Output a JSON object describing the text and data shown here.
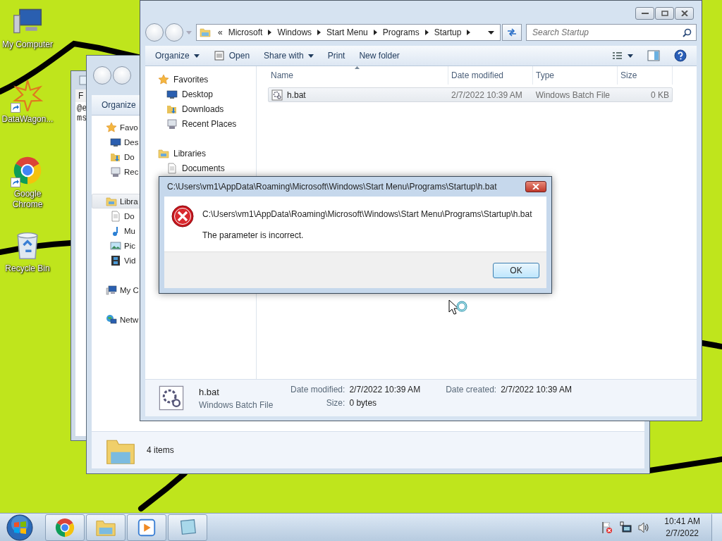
{
  "desktop_icons": [
    {
      "label": "My Computer",
      "kind": "computer",
      "shortcut": false
    },
    {
      "label": "DataWagon...",
      "kind": "star",
      "shortcut": true
    },
    {
      "label": "Google Chrome",
      "kind": "chrome",
      "shortcut": true
    },
    {
      "label": "Recycle Bin",
      "kind": "recycle",
      "shortcut": false
    }
  ],
  "notepad": {
    "menu": "F",
    "lines": [
      "@e",
      "ms"
    ]
  },
  "back_explorer": {
    "toolbar": "Organize",
    "sidebar": [
      {
        "label": "Favo",
        "kind": "star",
        "selected": false,
        "children": [
          {
            "label": "Des",
            "kind": "desktop",
            "selected": false
          },
          {
            "label": "Do",
            "kind": "downloads",
            "selected": false
          },
          {
            "label": "Rec",
            "kind": "recent",
            "selected": false
          }
        ]
      },
      {
        "label": "Libra",
        "kind": "library",
        "selected": true,
        "children": [
          {
            "label": "Do",
            "kind": "documents",
            "selected": false
          },
          {
            "label": "Mu",
            "kind": "music",
            "selected": false
          },
          {
            "label": "Pic",
            "kind": "pictures",
            "selected": false
          },
          {
            "label": "Vid",
            "kind": "video",
            "selected": false
          }
        ]
      },
      {
        "label": "My C",
        "kind": "computer",
        "selected": false
      },
      {
        "label": "Netw",
        "kind": "network",
        "selected": false
      }
    ],
    "status": "4 items"
  },
  "explorer": {
    "breadcrumb_overflow": "«",
    "breadcrumb": [
      "Microsoft",
      "Windows",
      "Start Menu",
      "Programs",
      "Startup"
    ],
    "search": {
      "placeholder": "Search Startup"
    },
    "toolbar": [
      {
        "label": "Organize",
        "kind": "menu"
      },
      {
        "label": "Open",
        "kind": "open"
      },
      {
        "label": "Share with",
        "kind": "menu"
      },
      {
        "label": "Print",
        "kind": "plain"
      },
      {
        "label": "New folder",
        "kind": "plain"
      }
    ],
    "sidebar": [
      {
        "label": "Favorites",
        "kind": "star",
        "children": [
          {
            "label": "Desktop",
            "kind": "desktop"
          },
          {
            "label": "Downloads",
            "kind": "downloads"
          },
          {
            "label": "Recent Places",
            "kind": "recent"
          }
        ]
      },
      {
        "label": "Libraries",
        "kind": "library",
        "children": [
          {
            "label": "Documents",
            "kind": "documents"
          }
        ]
      }
    ],
    "columns": [
      "Name",
      "Date modified",
      "Type",
      "Size"
    ],
    "rows": [
      {
        "name": "h.bat",
        "date_modified": "2/7/2022 10:39 AM",
        "type": "Windows Batch File",
        "size": "0 KB",
        "selected": true
      }
    ],
    "details": {
      "name": "h.bat",
      "type": "Windows Batch File",
      "fields": [
        {
          "label": "Date modified:",
          "value": "2/7/2022 10:39 AM"
        },
        {
          "label": "Date created:",
          "value": "2/7/2022 10:39 AM"
        },
        {
          "label": "Size:",
          "value": "0 bytes"
        }
      ]
    }
  },
  "dialog": {
    "title": "C:\\Users\\vm1\\AppData\\Roaming\\Microsoft\\Windows\\Start Menu\\Programs\\Startup\\h.bat",
    "path": "C:\\Users\\vm1\\AppData\\Roaming\\Microsoft\\Windows\\Start Menu\\Programs\\Startup\\h.bat",
    "message": "The parameter is incorrect.",
    "button": "OK"
  },
  "taskbar": {
    "apps": [
      {
        "kind": "chrome"
      },
      {
        "kind": "explorer"
      },
      {
        "kind": "media"
      },
      {
        "kind": "app"
      }
    ],
    "clock": {
      "time": "10:41 AM",
      "date": "2/7/2022"
    }
  }
}
